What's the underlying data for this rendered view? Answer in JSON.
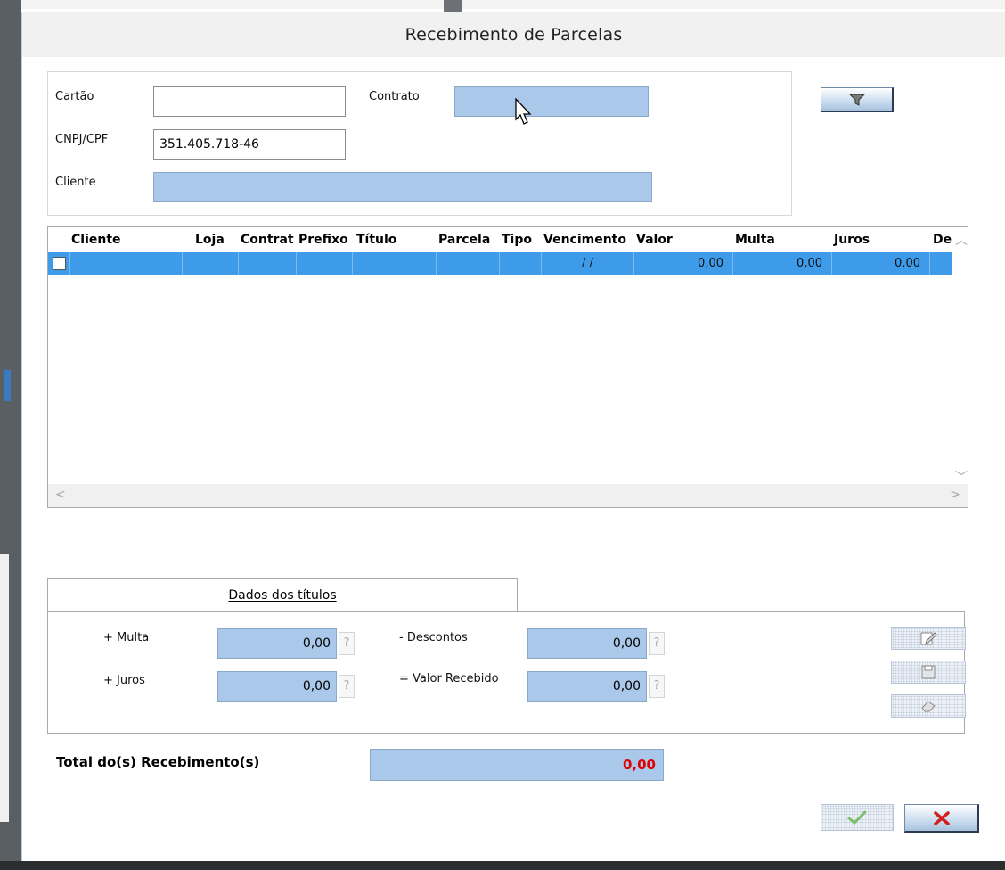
{
  "window": {
    "title": "Recebimento de Parcelas"
  },
  "filters": {
    "cartao_label": "Cartão",
    "cartao_value": "",
    "contrato_label": "Contrato",
    "contrato_value": "",
    "cnpj_label": "CNPJ/CPF",
    "cnpj_value": "351.405.718-46",
    "cliente_label": "Cliente",
    "cliente_value": "",
    "filter_icon": "funnel-icon"
  },
  "grid": {
    "columns": [
      "Cliente",
      "Loja",
      "Contrat",
      "Prefixo",
      "Título",
      "Parcela",
      "Tipo",
      "Vencimento",
      "Valor",
      "Multa",
      "Juros",
      "Des"
    ],
    "row": {
      "checked": false,
      "cliente": "",
      "loja": "",
      "contrato": "",
      "prefixo": "",
      "titulo": "",
      "parcela": "",
      "tipo": "",
      "vencimento": "/ /",
      "valor": "0,00",
      "multa": "0,00",
      "juros": "0,00"
    },
    "selected_row_color": "#3d9be9"
  },
  "tabs": {
    "dados_titulos": "Dados dos títulos"
  },
  "totals": {
    "multa_label": "+ Multa",
    "multa_value": "0,00",
    "juros_label": "+ Juros",
    "juros_value": "0,00",
    "descontos_label": "- Descontos",
    "descontos_value": "0,00",
    "valor_recebido_label": "= Valor Recebido",
    "valor_recebido_value": "0,00",
    "help_glyph": "?",
    "total_label": "Total do(s) Recebimento(s)",
    "total_value": "0,00",
    "total_color": "#e00000"
  },
  "side_buttons": [
    "edit-icon",
    "save-icon",
    "eraser-icon"
  ],
  "actions": {
    "confirm_icon": "checkmark-icon",
    "cancel_icon": "close-x-icon"
  }
}
